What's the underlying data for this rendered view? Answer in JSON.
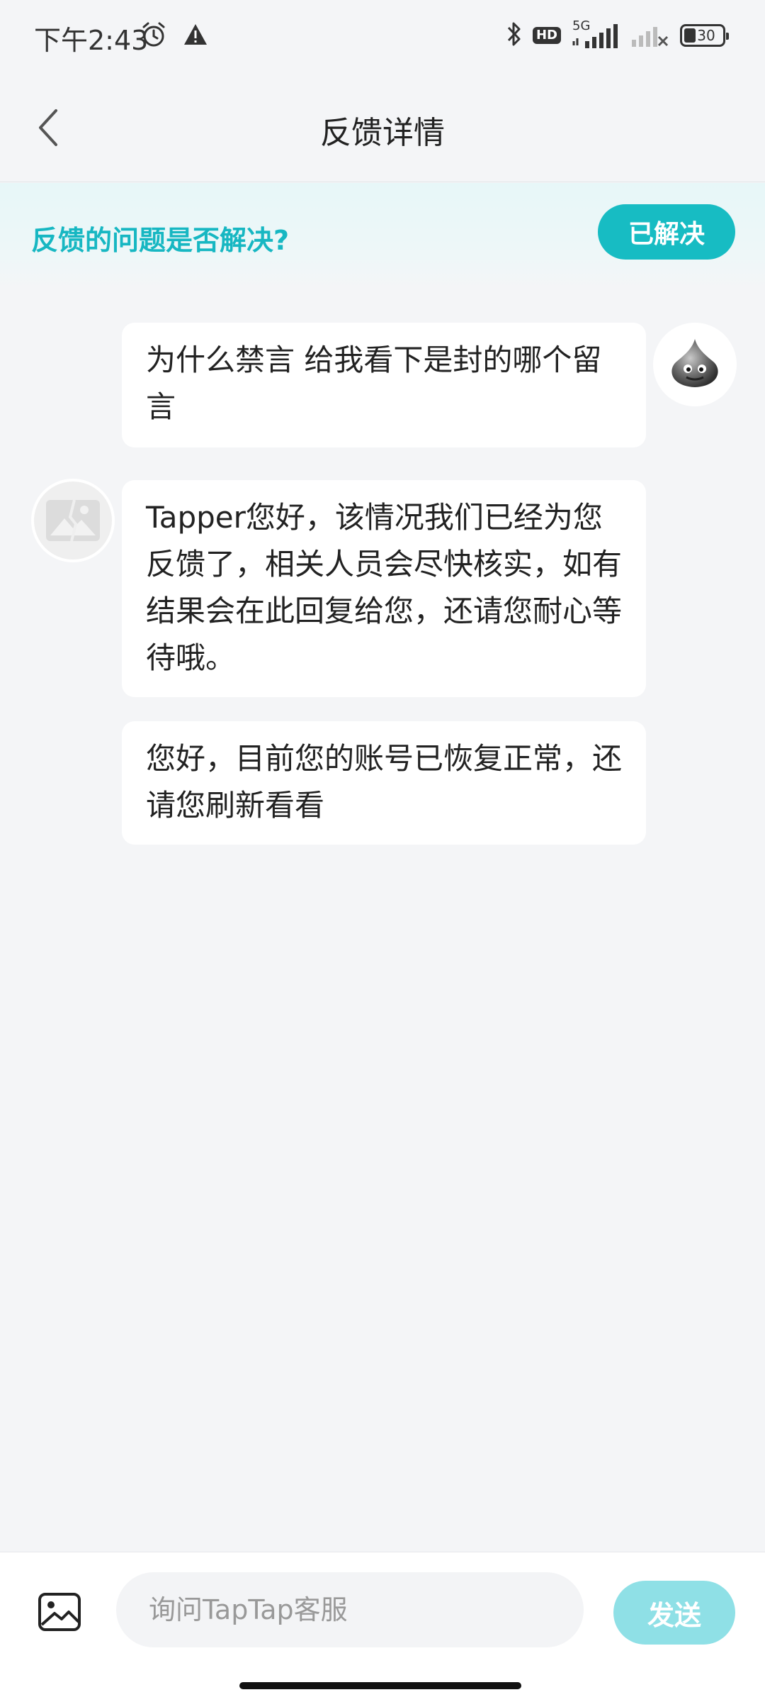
{
  "status_bar": {
    "time": "下午2:43",
    "network": "5G",
    "hd": "HD",
    "battery": "30"
  },
  "header": {
    "title": "反馈详情"
  },
  "resolve_banner": {
    "question": "反馈的问题是否解决?",
    "button_label": "已解决"
  },
  "messages": [
    {
      "sender": "user",
      "text": "为什么禁言 给我看下是封的哪个留言"
    },
    {
      "sender": "support",
      "text": "Tapper您好，该情况我们已经为您反馈了，相关人员会尽快核实，如有结果会在此回复给您，还请您耐心等待哦。"
    },
    {
      "sender": "support",
      "text": "您好，目前您的账号已恢复正常，还请您刷新看看"
    }
  ],
  "composer": {
    "input_value": "",
    "placeholder": "询问TapTap客服",
    "send_label": "发送"
  },
  "colors": {
    "accent": "#17bcc3",
    "send_disabled": "#8fe0e6",
    "background": "#f4f5f7"
  }
}
